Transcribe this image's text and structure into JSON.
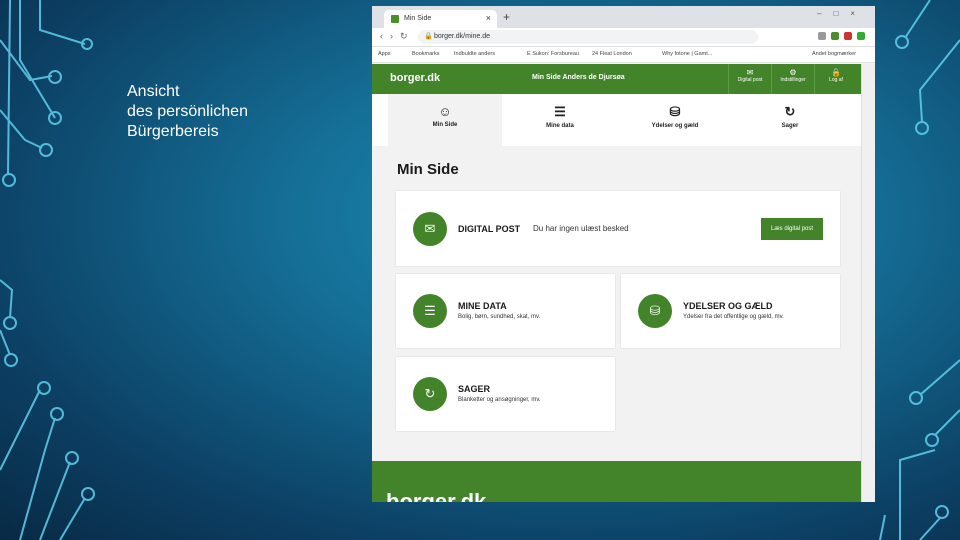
{
  "caption": {
    "line1": "Ansicht",
    "line2": "des persönlichen",
    "line3": "Bürgerbereis"
  },
  "browser": {
    "tab_title": "Min Side",
    "url": "borger.dk/mine.de",
    "bookmarks": [
      "Apps",
      "Bookmarks",
      "Indbuldte anders",
      "E Sukon: Forsbureau",
      "24 Fleat London",
      "Why fotone | Gamt...",
      "Andet bogmærker"
    ]
  },
  "site": {
    "logo": "borger.dk",
    "header_user": "Min Side   Anders de Djursøa",
    "header_buttons": [
      "Digital post",
      "Indstillinger",
      "Log af"
    ],
    "nav": [
      "Min Side",
      "Mine data",
      "Ydelser og gæld",
      "Sager"
    ],
    "page_title": "Min Side",
    "digital_post": {
      "title": "DIGITAL POST",
      "message": "Du har ingen ulæst besked",
      "button": "Læs digital post"
    },
    "mine_data": {
      "title": "MINE DATA",
      "sub": "Bolig, børn, sundhed, skat, mv."
    },
    "ydelser": {
      "title": "YDELSER OG GÆLD",
      "sub": "Ydelser fra det offentlige og gæld, mv."
    },
    "sager": {
      "title": "SAGER",
      "sub": "Blanketter og ansøgninger, mv."
    },
    "footer_logo": "borger.dk"
  },
  "colors": {
    "brand_green": "#43842b",
    "bg_blue": "#156f97"
  }
}
